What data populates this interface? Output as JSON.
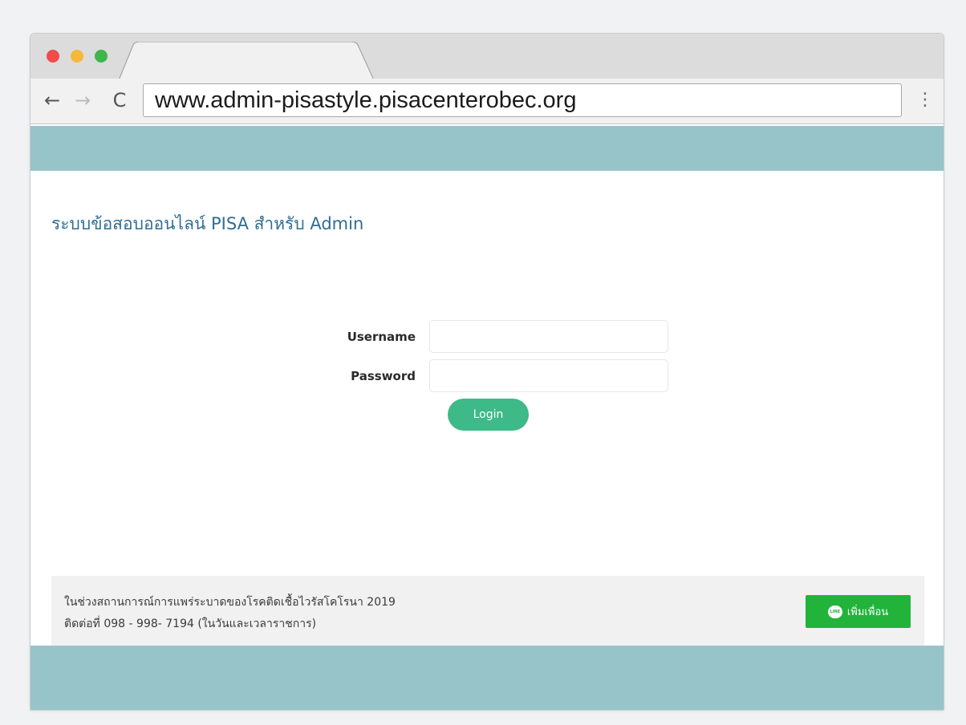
{
  "browser": {
    "url": "www.admin-pisastyle.pisacenterobec.org",
    "back_icon": "←",
    "forward_icon": "→",
    "reload_icon": "C",
    "menu_icon": "⋮"
  },
  "page": {
    "title": "ระบบข้อสอบออนไลน์ PISA สำหรับ Admin"
  },
  "login_form": {
    "username_label": "Username",
    "username_value": "",
    "password_label": "Password",
    "password_value": "",
    "login_button": "Login"
  },
  "footer": {
    "line1": "ในช่วงสถานการณ์การแพร่ระบาดของโรคติดเชื้อไวรัสโคโรนา 2019",
    "line2": "ติดต่อที่ 098 - 998- 7194 (ในวันและเวลาราชการ)",
    "add_friend_button": "เพิ่มเพื่อน",
    "line_icon_text": "LINE"
  },
  "colors": {
    "header_bar": "#97c4c9",
    "title_text": "#2f6e93",
    "login_button": "#3dba88",
    "line_button": "#21b33a"
  }
}
